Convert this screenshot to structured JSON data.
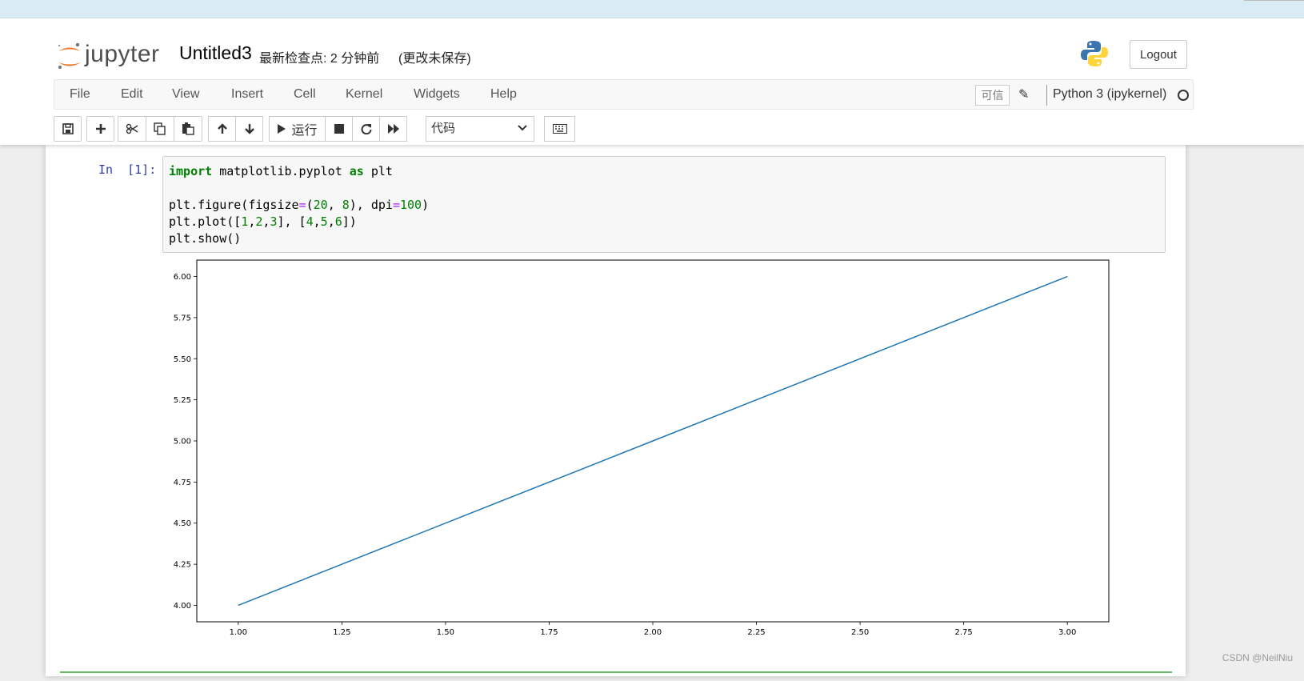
{
  "header": {
    "logo_text": "jupyter",
    "notebook_title": "Untitled3",
    "checkpoint_text": "最新检查点: 2 分钟前",
    "unsaved_text": "(更改未保存)",
    "logout_label": "Logout"
  },
  "menubar": {
    "items": [
      "File",
      "Edit",
      "View",
      "Insert",
      "Cell",
      "Kernel",
      "Widgets",
      "Help"
    ],
    "trusted_label": "可信",
    "kernel_name": "Python 3 (ipykernel)"
  },
  "toolbar": {
    "run_label": "运行",
    "cell_type": "代码",
    "icons": [
      "save-icon",
      "plus-icon",
      "cut-icon",
      "copy-icon",
      "paste-icon",
      "arrow-up-icon",
      "arrow-down-icon",
      "run-icon",
      "stop-icon",
      "restart-icon",
      "fast-forward-icon",
      "keyboard-icon"
    ]
  },
  "cell": {
    "prompt": "In  [1]:",
    "code": [
      "import matplotlib.pyplot as plt",
      "",
      "plt.figure(figsize=(20, 8), dpi=100)",
      "plt.plot([1,2,3], [4,5,6])",
      "plt.show()"
    ]
  },
  "chart_data": {
    "type": "line",
    "x": [
      1,
      2,
      3
    ],
    "series": [
      {
        "values": [
          4,
          5,
          6
        ],
        "color": "#1f77b4"
      }
    ],
    "xlim": [
      0.9,
      3.1
    ],
    "ylim": [
      3.9,
      6.1
    ],
    "xticks": [
      "1.00",
      "1.25",
      "1.50",
      "1.75",
      "2.00",
      "2.25",
      "2.50",
      "2.75",
      "3.00"
    ],
    "yticks": [
      "4.00",
      "4.25",
      "4.50",
      "4.75",
      "5.00",
      "5.25",
      "5.50",
      "5.75",
      "6.00"
    ],
    "grid": false
  },
  "watermark": "CSDN @NeilNiu"
}
